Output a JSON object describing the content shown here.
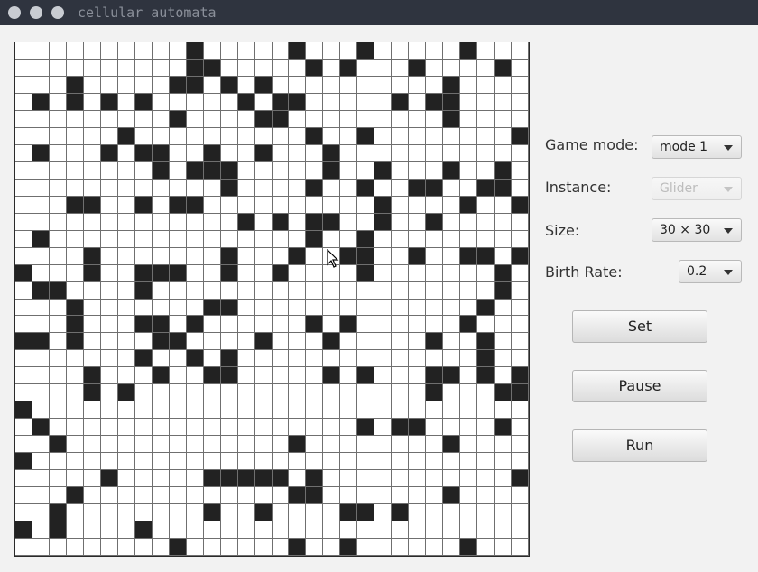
{
  "window": {
    "title": "cellular automata"
  },
  "controls": {
    "game_mode_label": "Game mode:",
    "game_mode_value": "mode 1",
    "instance_label": "Instance:",
    "instance_value": "Glider",
    "size_label": "Size:",
    "size_value": "30 × 30",
    "birth_rate_label": "Birth Rate:",
    "birth_rate_value": "0.2"
  },
  "buttons": {
    "set": "Set",
    "pause": "Pause",
    "run": "Run"
  },
  "grid": {
    "rows": 30,
    "cols": 30,
    "alive_color": "#222222",
    "dead_color": "#ffffff",
    "line_color": "#6f6f6f",
    "alive": [
      [
        10,
        16,
        20,
        26
      ],
      [
        10,
        11,
        17,
        19,
        23,
        28
      ],
      [
        3,
        9,
        10,
        12,
        14,
        25
      ],
      [
        1,
        3,
        5,
        7,
        13,
        15,
        16,
        22,
        24,
        25
      ],
      [
        9,
        14,
        15,
        25
      ],
      [
        6,
        17,
        20,
        29
      ],
      [
        1,
        5,
        7,
        8,
        11,
        14,
        18
      ],
      [
        8,
        10,
        11,
        12,
        18,
        21,
        25,
        28
      ],
      [
        12,
        17,
        20,
        23,
        24,
        27,
        28
      ],
      [
        3,
        4,
        7,
        9,
        10,
        21,
        26,
        29
      ],
      [
        13,
        15,
        17,
        18,
        21,
        24
      ],
      [
        1,
        17,
        20
      ],
      [
        4,
        12,
        16,
        19,
        20,
        23,
        26,
        27,
        29
      ],
      [
        0,
        4,
        7,
        8,
        9,
        12,
        15,
        20,
        28
      ],
      [
        1,
        2,
        7,
        28
      ],
      [
        3,
        11,
        12,
        27
      ],
      [
        3,
        7,
        8,
        10,
        17,
        19,
        26
      ],
      [
        0,
        1,
        3,
        8,
        9,
        14,
        18,
        24,
        27
      ],
      [
        7,
        10,
        12,
        27
      ],
      [
        4,
        8,
        11,
        12,
        18,
        20,
        24,
        25,
        27,
        29
      ],
      [
        4,
        6,
        24,
        28,
        29
      ],
      [
        0
      ],
      [
        1,
        20,
        22,
        23,
        28
      ],
      [
        2,
        16,
        25
      ],
      [
        0
      ],
      [
        5,
        11,
        12,
        13,
        14,
        15,
        17,
        29
      ],
      [
        3,
        16,
        17,
        25
      ],
      [
        2,
        11,
        14,
        19,
        20,
        22
      ],
      [
        0,
        2,
        7
      ],
      [
        9,
        16,
        19,
        26
      ]
    ]
  }
}
